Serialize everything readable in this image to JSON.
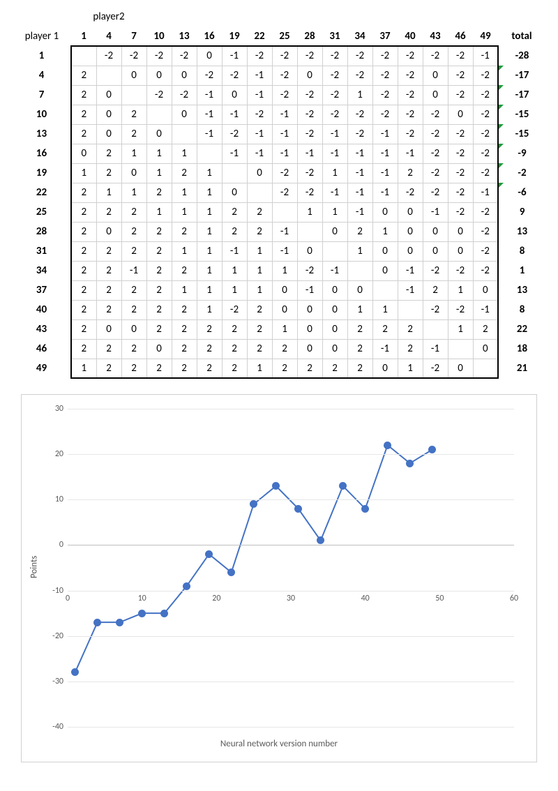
{
  "labels": {
    "player1": "player 1",
    "player2": "player2",
    "total": "total"
  },
  "columns": [
    1,
    4,
    7,
    10,
    13,
    16,
    19,
    22,
    25,
    28,
    31,
    34,
    37,
    40,
    43,
    46,
    49
  ],
  "rows": [
    1,
    4,
    7,
    10,
    13,
    16,
    19,
    22,
    25,
    28,
    31,
    34,
    37,
    40,
    43,
    46,
    49
  ],
  "matrix": [
    [
      null,
      -2,
      -2,
      -2,
      -2,
      0,
      -1,
      -2,
      -2,
      -2,
      -2,
      -2,
      -2,
      -2,
      -2,
      -2,
      -1
    ],
    [
      2,
      null,
      0,
      0,
      0,
      -2,
      -2,
      -1,
      -2,
      0,
      -2,
      -2,
      -2,
      -2,
      0,
      -2,
      -2
    ],
    [
      2,
      0,
      null,
      -2,
      -2,
      -1,
      0,
      -1,
      -2,
      -2,
      -2,
      1,
      -2,
      -2,
      0,
      -2,
      -2
    ],
    [
      2,
      0,
      2,
      null,
      0,
      -1,
      -1,
      -2,
      -1,
      -2,
      -2,
      -2,
      -2,
      -2,
      -2,
      0,
      -2
    ],
    [
      2,
      0,
      2,
      0,
      null,
      -1,
      -2,
      -1,
      -1,
      -2,
      -1,
      -2,
      -1,
      -2,
      -2,
      -2,
      -2
    ],
    [
      0,
      2,
      1,
      1,
      1,
      null,
      -1,
      -1,
      -1,
      -1,
      -1,
      -1,
      -1,
      -1,
      -2,
      -2,
      -2
    ],
    [
      1,
      2,
      0,
      1,
      2,
      1,
      null,
      0,
      -2,
      -2,
      1,
      -1,
      -1,
      2,
      -2,
      -2,
      -2
    ],
    [
      2,
      1,
      1,
      2,
      1,
      1,
      0,
      null,
      -2,
      -2,
      -1,
      -1,
      -1,
      -2,
      -2,
      -2,
      -1
    ],
    [
      2,
      2,
      2,
      1,
      1,
      1,
      2,
      2,
      null,
      1,
      1,
      -1,
      0,
      0,
      -1,
      -2,
      -2
    ],
    [
      2,
      0,
      2,
      2,
      2,
      1,
      2,
      2,
      -1,
      null,
      0,
      2,
      1,
      0,
      0,
      0,
      -2
    ],
    [
      2,
      2,
      2,
      2,
      1,
      1,
      -1,
      1,
      -1,
      0,
      null,
      1,
      0,
      0,
      0,
      0,
      -2
    ],
    [
      2,
      2,
      -1,
      2,
      2,
      1,
      1,
      1,
      1,
      -2,
      -1,
      null,
      0,
      -1,
      -2,
      -2,
      -2
    ],
    [
      2,
      2,
      2,
      2,
      1,
      1,
      1,
      1,
      0,
      -1,
      0,
      0,
      null,
      -1,
      2,
      1,
      0
    ],
    [
      2,
      2,
      2,
      2,
      2,
      1,
      -2,
      2,
      0,
      0,
      0,
      1,
      1,
      null,
      -2,
      -2,
      -1
    ],
    [
      2,
      0,
      0,
      2,
      2,
      2,
      2,
      2,
      1,
      0,
      0,
      2,
      2,
      2,
      null,
      1,
      2
    ],
    [
      2,
      2,
      2,
      0,
      2,
      2,
      2,
      2,
      2,
      0,
      0,
      2,
      -1,
      2,
      -1,
      null,
      0
    ],
    [
      1,
      2,
      2,
      2,
      2,
      2,
      2,
      1,
      2,
      2,
      2,
      2,
      0,
      1,
      -2,
      0,
      null
    ]
  ],
  "totals": [
    -28,
    -17,
    -17,
    -15,
    -15,
    -9,
    -2,
    -6,
    9,
    13,
    8,
    1,
    13,
    8,
    22,
    18,
    21
  ],
  "marked_totals": [
    false,
    true,
    true,
    true,
    true,
    true,
    true,
    true,
    false,
    false,
    false,
    false,
    false,
    false,
    false,
    false,
    false
  ],
  "chart_data": {
    "type": "line",
    "x": [
      1,
      4,
      7,
      10,
      13,
      16,
      19,
      22,
      25,
      28,
      31,
      34,
      37,
      40,
      43,
      46,
      49
    ],
    "y": [
      -28,
      -17,
      -17,
      -15,
      -15,
      -9,
      -2,
      -6,
      9,
      13,
      8,
      1,
      13,
      8,
      22,
      18,
      21
    ],
    "xlabel": "Neural network version number",
    "ylabel": "Points",
    "xlim": [
      0,
      60
    ],
    "ylim": [
      -40,
      30
    ],
    "xticks": [
      0,
      10,
      20,
      30,
      40,
      50,
      60
    ],
    "yticks": [
      -40,
      -30,
      -20,
      -10,
      0,
      10,
      20,
      30
    ],
    "marker_color": "#4472C4",
    "line_color": "#4472C4"
  }
}
